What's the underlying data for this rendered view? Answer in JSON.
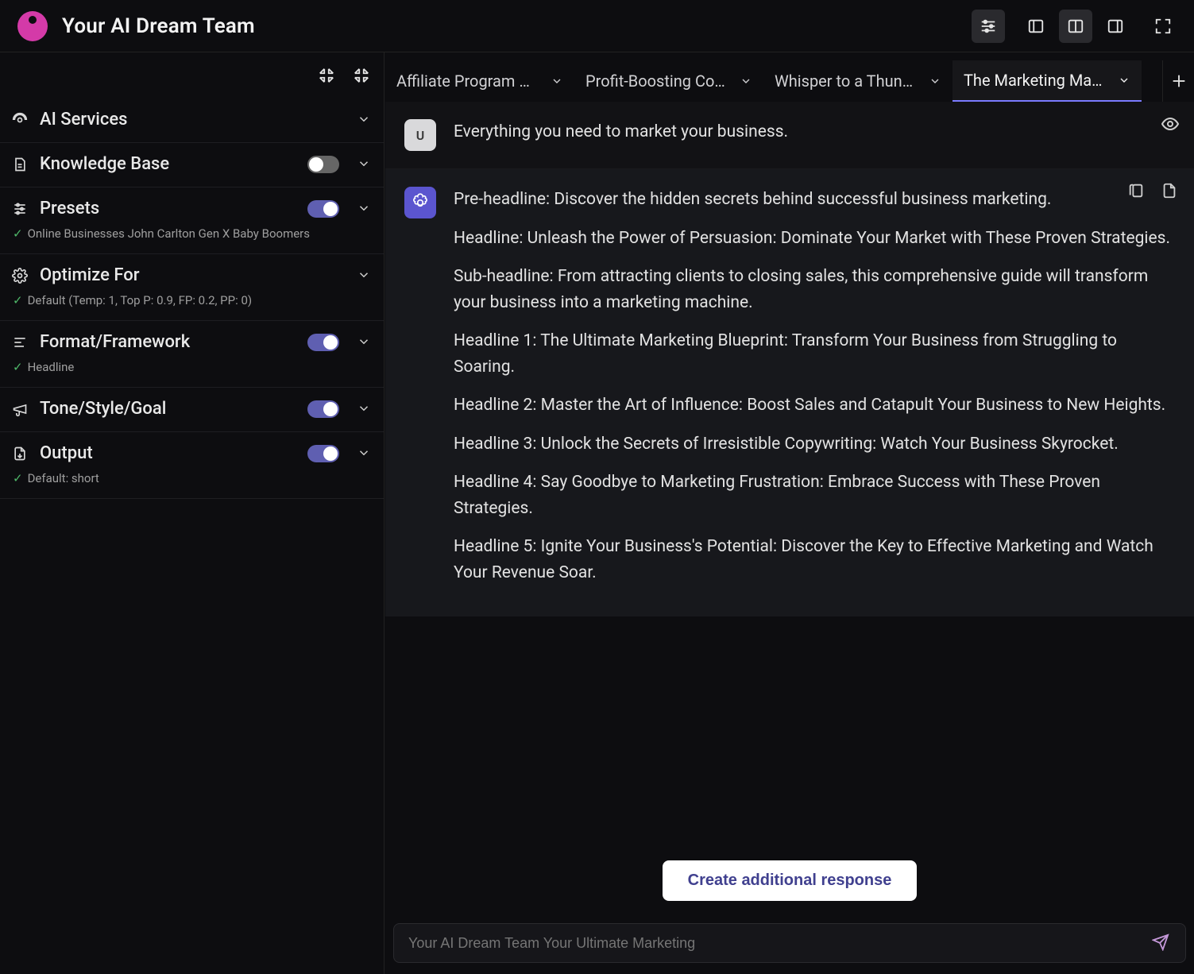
{
  "header": {
    "title": "Your AI Dream Team"
  },
  "tabs": [
    {
      "label": "Affiliate Program Br…",
      "active": false
    },
    {
      "label": "Profit-Boosting Cop…",
      "active": false
    },
    {
      "label": "Whisper to a Thunder",
      "active": false
    },
    {
      "label": "The Marketing Mast…",
      "active": true
    }
  ],
  "sidebar": {
    "sections": [
      {
        "id": "ai-services",
        "title": "AI Services",
        "toggle": null,
        "sub": null
      },
      {
        "id": "knowledge-base",
        "title": "Knowledge Base",
        "toggle": false,
        "sub": null
      },
      {
        "id": "presets",
        "title": "Presets",
        "toggle": true,
        "sub": "Online Businesses John Carlton Gen X Baby Boomers"
      },
      {
        "id": "optimize-for",
        "title": "Optimize For",
        "toggle": null,
        "sub": "Default (Temp: 1, Top P: 0.9, FP: 0.2, PP: 0)"
      },
      {
        "id": "format-framework",
        "title": "Format/Framework",
        "toggle": true,
        "sub": "Headline"
      },
      {
        "id": "tone-style-goal",
        "title": "Tone/Style/Goal",
        "toggle": true,
        "sub": null
      },
      {
        "id": "output",
        "title": "Output",
        "toggle": true,
        "sub": "Default: short"
      }
    ]
  },
  "chat": {
    "user_avatar": "U",
    "user_msg": "Everything you need to market your business.",
    "ai_paragraphs": [
      "Pre-headline: Discover the hidden secrets behind successful business marketing.",
      "Headline: Unleash the Power of Persuasion: Dominate Your Market with These Proven Strategies.",
      "Sub-headline: From attracting clients to closing sales, this comprehensive guide will transform your business into a marketing machine.",
      "Headline 1: The Ultimate Marketing Blueprint: Transform Your Business from Struggling to Soaring.",
      "Headline 2: Master the Art of Influence: Boost Sales and Catapult Your Business to New Heights.",
      "Headline 3: Unlock the Secrets of Irresistible Copywriting: Watch Your Business Skyrocket.",
      "Headline 4: Say Goodbye to Marketing Frustration: Embrace Success with These Proven Strategies.",
      "Headline 5: Ignite Your Business's Potential: Discover the Key to Effective Marketing and Watch Your Revenue Soar."
    ]
  },
  "additional_button": "Create additional response",
  "composer": {
    "placeholder": "Your AI Dream Team Your Ultimate Marketing"
  }
}
